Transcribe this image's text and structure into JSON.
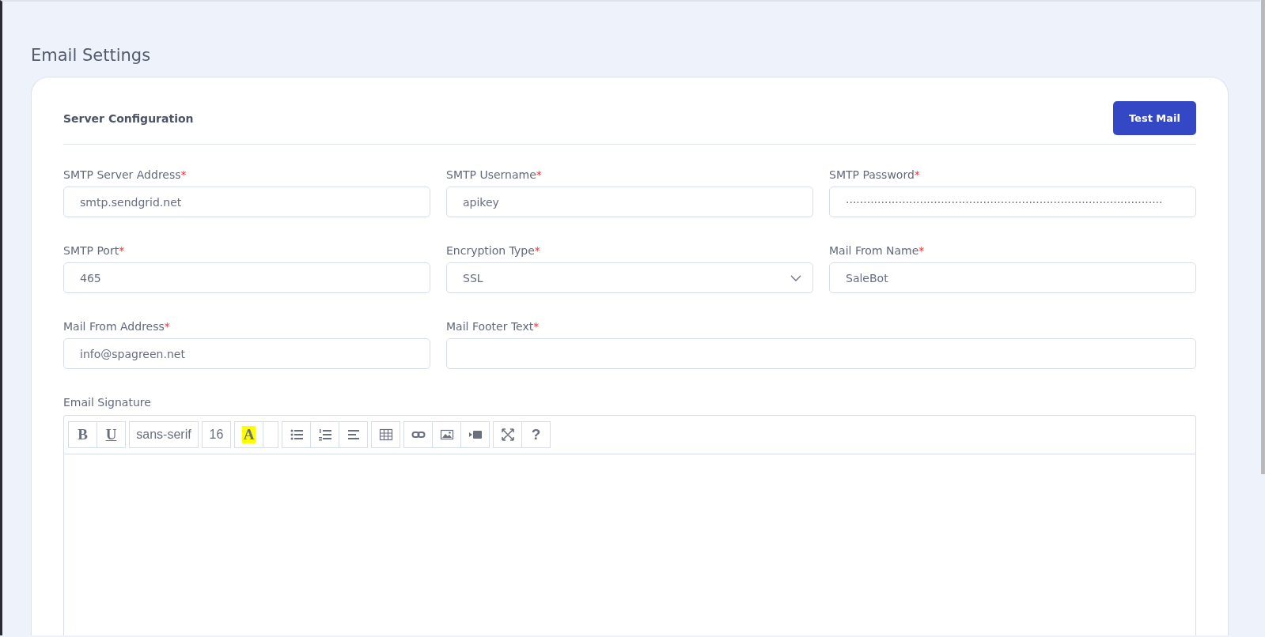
{
  "page_title": "Email Settings",
  "card": {
    "title": "Server Configuration",
    "button": "Test Mail"
  },
  "fields": [
    {
      "label": "SMTP Server Address",
      "mark": "*",
      "kind": "text",
      "value": "smtp.sendgrid.net"
    },
    {
      "label": "SMTP Username",
      "mark": "*",
      "kind": "text",
      "value": "apikey"
    },
    {
      "label": "SMTP Password",
      "mark": "*",
      "kind": "text",
      "value": "··························································································"
    },
    {
      "label": "SMTP Port",
      "mark": "*",
      "kind": "text",
      "value": "465"
    },
    {
      "label": "Encryption Type",
      "mark": "*",
      "kind": "select",
      "value": "SSL"
    },
    {
      "label": "Mail From Name",
      "mark": "*",
      "kind": "text",
      "value": "SaleBot"
    },
    {
      "label": "Mail From Address",
      "mark": "*",
      "kind": "text",
      "value": "info@spagreen.net"
    },
    {
      "label": "Mail Footer Text",
      "mark": "*",
      "kind": "wide"
    }
  ],
  "signature": {
    "label": "Email Signature",
    "toolbar": [
      [
        {
          "kind": "bold",
          "text": "B"
        },
        {
          "kind": "underline",
          "text": "U"
        }
      ],
      [
        {
          "kind": "font",
          "text": "sans-serif"
        }
      ],
      [
        {
          "kind": "size",
          "text": "16"
        }
      ],
      [
        {
          "kind": "highlight",
          "text": "A"
        },
        {
          "kind": "blank"
        }
      ],
      [
        {
          "kind": "bullets"
        },
        {
          "kind": "numbers"
        },
        {
          "kind": "align"
        }
      ],
      [
        {
          "kind": "table"
        }
      ],
      [
        {
          "kind": "link"
        },
        {
          "kind": "image"
        },
        {
          "kind": "video"
        }
      ],
      [
        {
          "kind": "fullscreen"
        },
        {
          "kind": "help",
          "text": "?"
        }
      ]
    ]
  }
}
